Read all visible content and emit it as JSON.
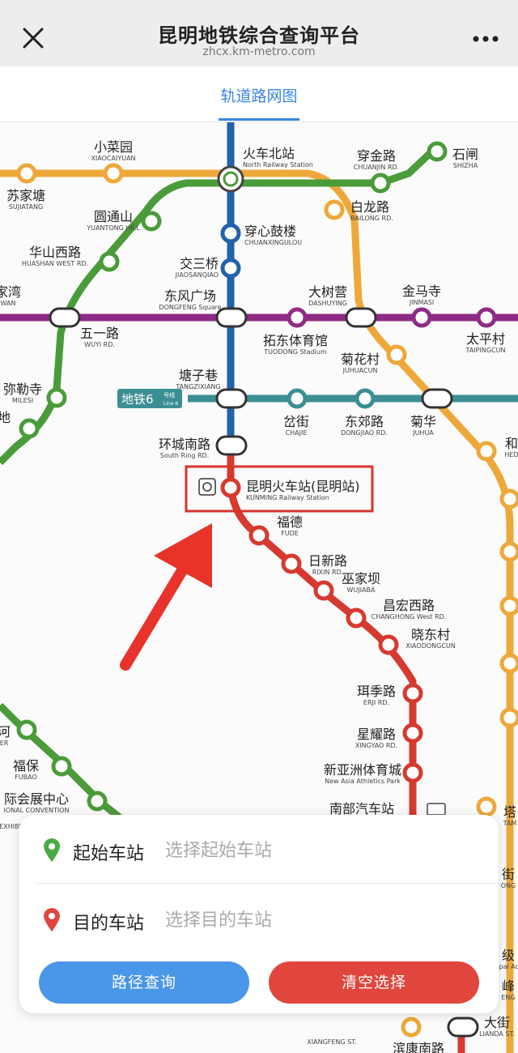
{
  "header": {
    "title": "昆明地铁综合查询平台",
    "url": "zhcx.km-metro.com",
    "close_icon": "close-icon",
    "more_icon": "more-icon"
  },
  "tabs": [
    {
      "label": "轨道路网图",
      "active": true
    }
  ],
  "colors": {
    "accent": "#3a86e0",
    "line1": "#d63a2f",
    "line2": "#2262a8",
    "line3": "#8f2b86",
    "line4": "#eea83a",
    "line5": "#4a9b3a",
    "line6": "#3b8f93",
    "highlight": "#d6342c"
  },
  "map": {
    "line6_badge": {
      "name": "地铁6",
      "sub": "号线",
      "en": "Line 6"
    },
    "stations": [
      {
        "id": "xiaocaiyuan",
        "cn": "小菜园",
        "en": "XIAOCAIYUAN"
      },
      {
        "id": "huochebeizhan",
        "cn": "火车北站",
        "en": "North Railway Station"
      },
      {
        "id": "chuanjinlu",
        "cn": "穿金路",
        "en": "CHUANJIN RD."
      },
      {
        "id": "shizha",
        "cn": "石闸",
        "en": "SHIZHA"
      },
      {
        "id": "sujiatang",
        "cn": "苏家塘",
        "en": "SUJIATANG"
      },
      {
        "id": "bailonglu",
        "cn": "白龙路",
        "en": "BAILONG RD."
      },
      {
        "id": "yuantongshan",
        "cn": "圆通山",
        "en": "YUANTONG HILL"
      },
      {
        "id": "chuanxingulou",
        "cn": "穿心鼓楼",
        "en": "CHUANXINGULOU"
      },
      {
        "id": "huashanxilu",
        "cn": "华山西路",
        "en": "HUASHAN WEST RD."
      },
      {
        "id": "jiaosanqiao",
        "cn": "交三桥",
        "en": "JIAOSANQIAO"
      },
      {
        "id": "jiawan",
        "cn": "家湾",
        "en": "WAN"
      },
      {
        "id": "dongfengguangchang",
        "cn": "东风广场",
        "en": "DONGFENG Square"
      },
      {
        "id": "dashuying",
        "cn": "大树营",
        "en": "DASHUYING"
      },
      {
        "id": "jinmasi",
        "cn": "金马寺",
        "en": "JINMASI"
      },
      {
        "id": "wuyilu",
        "cn": "五一路",
        "en": "WUYI RD."
      },
      {
        "id": "tuodongtiyuguan",
        "cn": "拓东体育馆",
        "en": "TUODONG Stadium"
      },
      {
        "id": "taipingcun",
        "cn": "太平村",
        "en": "TAIPINGCUN"
      },
      {
        "id": "juhuacun",
        "cn": "菊花村",
        "en": "JUHUACUN"
      },
      {
        "id": "mileisi",
        "cn": "弥勒寺",
        "en": "MILESI"
      },
      {
        "id": "tangzixiang",
        "cn": "塘子巷",
        "en": "TANGZIXIANG"
      },
      {
        "id": "di",
        "cn": "地",
        "en": ""
      },
      {
        "id": "chajie",
        "cn": "岔街",
        "en": "CHAJIE"
      },
      {
        "id": "dongjiaolu",
        "cn": "东郊路",
        "en": "DONGJIAO RD."
      },
      {
        "id": "juhua",
        "cn": "菊华",
        "en": "JUHUA"
      },
      {
        "id": "he",
        "cn": "和",
        "en": "HED"
      },
      {
        "id": "huanchengnanlu",
        "cn": "环城南路",
        "en": "South Ring RD."
      },
      {
        "id": "kunminghuochezhan",
        "cn": "昆明火车站(昆明站)",
        "en": "KUNMING Railway Station"
      },
      {
        "id": "fude",
        "cn": "福德",
        "en": "FUDE"
      },
      {
        "id": "rixinlu",
        "cn": "日新路",
        "en": "RIXIN RD."
      },
      {
        "id": "wujiaba",
        "cn": "巫家坝",
        "en": "WUJIABA"
      },
      {
        "id": "changhongxilu",
        "cn": "昌宏西路",
        "en": "CHANGHONG West RD."
      },
      {
        "id": "xiaodongcun",
        "cn": "晓东村",
        "en": "XIAODONGCUN"
      },
      {
        "id": "erjilu",
        "cn": "珥季路",
        "en": "ERJI RD."
      },
      {
        "id": "xingyaolu",
        "cn": "星耀路",
        "en": "XINGYAO RD."
      },
      {
        "id": "xinyazhoutiyucheng",
        "cn": "新亚洲体育城",
        "en": "New Asia Athletics Park"
      },
      {
        "id": "he2",
        "cn": "河",
        "en": "ER"
      },
      {
        "id": "fubao",
        "cn": "福保",
        "en": "FUBAO"
      },
      {
        "id": "guojihuizhanzhongxin",
        "cn": "际会展中心",
        "en": "IONAL CONVENTION"
      },
      {
        "id": "exhibit",
        "cn": "",
        "en": "EXHIBIT"
      },
      {
        "id": "nanbuqichezhan",
        "cn": "南部汽车站",
        "en": ""
      },
      {
        "id": "ta",
        "cn": "塔",
        "en": "TAM"
      },
      {
        "id": "jie",
        "cn": "街",
        "en": "ONG"
      },
      {
        "id": "jiji",
        "cn": "级",
        "en": "ipal Ad"
      },
      {
        "id": "feng",
        "cn": "峰",
        "en": "ENG"
      },
      {
        "id": "dajie",
        "cn": "大街",
        "en": "LIANDA ST."
      },
      {
        "id": "xiangfeng",
        "cn": "",
        "en": "XIANGFENG ST."
      },
      {
        "id": "binkangnanlu",
        "cn": "滨康南路",
        "en": ""
      }
    ]
  },
  "search": {
    "origin_label": "起始车站",
    "origin_placeholder": "选择起始车站",
    "origin_value": "",
    "dest_label": "目的车站",
    "dest_placeholder": "选择目的车站",
    "dest_value": "",
    "query_button": "路径查询",
    "clear_button": "清空选择",
    "origin_pin_icon": "green-pin-icon",
    "dest_pin_icon": "red-pin-icon"
  }
}
